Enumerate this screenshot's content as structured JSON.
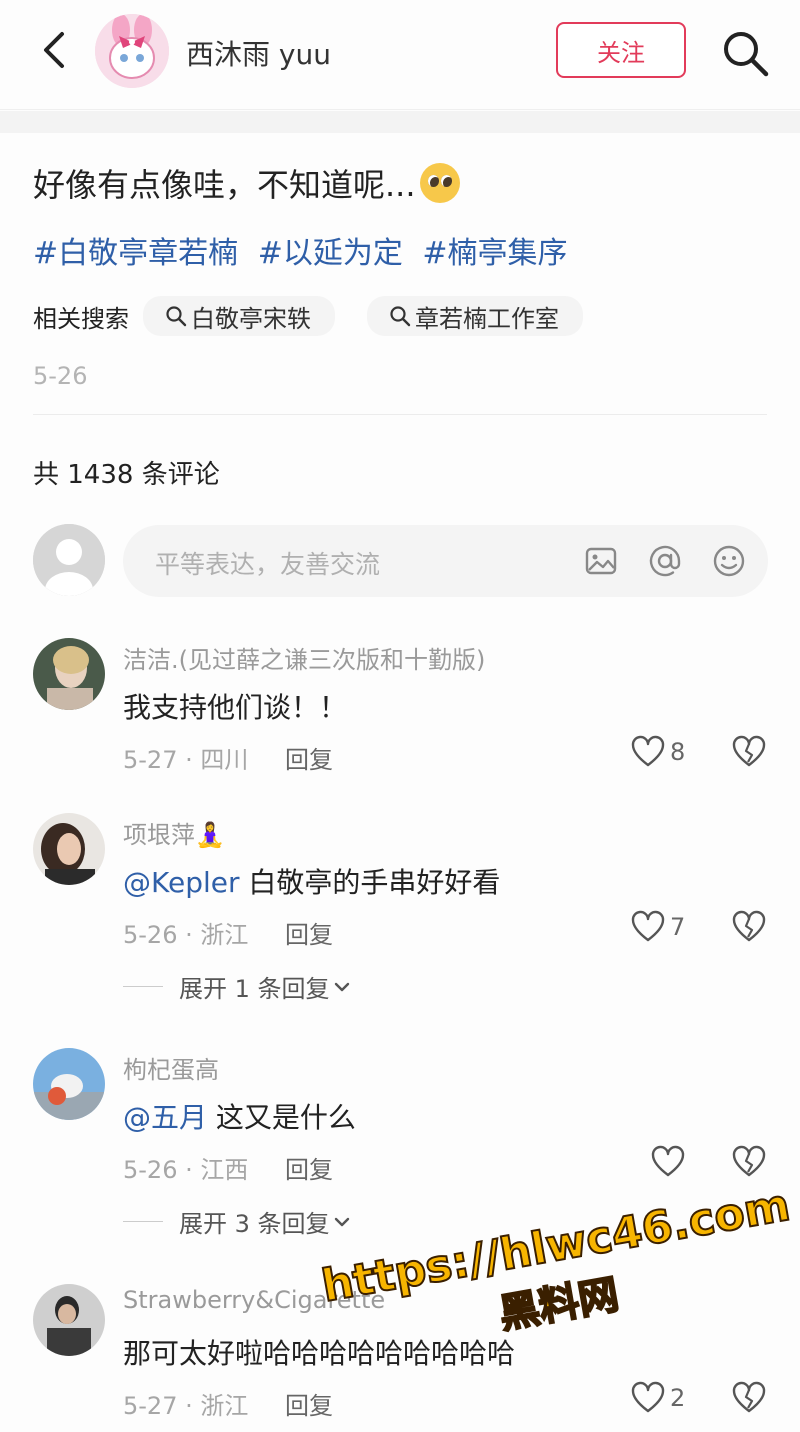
{
  "header": {
    "author": "西沐雨 yuu",
    "follow_label": "关注"
  },
  "post": {
    "title": "好像有点像哇，不知道呢...",
    "tags": [
      "#白敬亭章若楠",
      "#以延为定",
      "#楠亭集序"
    ],
    "related_label": "相关搜索",
    "related": [
      "白敬亭宋轶",
      "章若楠工作室"
    ],
    "date": "5-26"
  },
  "comments_header": {
    "count_text": "共 1438 条评论",
    "input_placeholder": "平等表达，友善交流"
  },
  "comments": [
    {
      "name": "洁洁.(见过薛之谦三次版和十勤版)",
      "text": "我支持他们谈！！",
      "mention": "",
      "meta": "5-27 · 四川",
      "reply": "回复",
      "likes": "8",
      "expand": ""
    },
    {
      "name": "项垠萍🧘‍♀️",
      "text": " 白敬亭的手串好好看",
      "mention": "@Kepler",
      "meta": "5-26 · 浙江",
      "reply": "回复",
      "likes": "7",
      "expand": "展开 1 条回复"
    },
    {
      "name": "枸杞蛋高",
      "text": " 这又是什么",
      "mention": "@五月",
      "meta": "5-26 · 江西",
      "reply": "回复",
      "likes": "",
      "expand": "展开 3 条回复"
    },
    {
      "name": "Strawberry&Cigarette",
      "text": "那可太好啦哈哈哈哈哈哈哈哈哈",
      "mention": "",
      "meta": "5-27 · 浙江",
      "reply": "回复",
      "likes": "2",
      "expand": ""
    }
  ],
  "watermark": {
    "url": "https://hlwc46.com",
    "name": "黑料网"
  },
  "colors": {
    "accent": "#e23b5a",
    "link": "#2f5fa8",
    "watermark": "#f7b500"
  }
}
